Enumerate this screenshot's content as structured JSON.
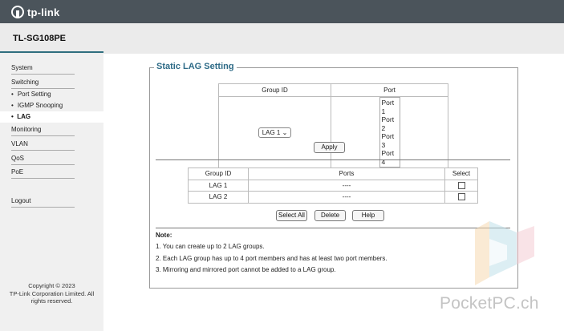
{
  "header": {
    "logo_text": "tp-link",
    "model": "TL-SG108PE"
  },
  "sidebar": {
    "items": [
      {
        "label": "System"
      },
      {
        "label": "Switching"
      },
      {
        "label": "Port Setting"
      },
      {
        "label": "IGMP Snooping"
      },
      {
        "label": "LAG"
      },
      {
        "label": "Monitoring"
      },
      {
        "label": "VLAN"
      },
      {
        "label": "QoS"
      },
      {
        "label": "PoE"
      },
      {
        "label": "Logout"
      }
    ],
    "active": "LAG",
    "copyright": "Copyright © 2023\nTP-Link Corporation Limited. All rights reserved."
  },
  "main": {
    "section_title": "Static LAG Setting",
    "config_table": {
      "headers": [
        "Group ID",
        "Port"
      ],
      "group_select_value": "LAG 1",
      "ports": [
        "Port 1",
        "Port 2",
        "Port 3",
        "Port 4"
      ]
    },
    "apply_label": "Apply",
    "lag_table": {
      "headers": [
        "Group ID",
        "Ports",
        "Select"
      ],
      "rows": [
        {
          "group": "LAG 1",
          "ports": "----"
        },
        {
          "group": "LAG 2",
          "ports": "----"
        }
      ]
    },
    "buttons": {
      "select_all": "Select All",
      "delete": "Delete",
      "help": "Help"
    },
    "note": {
      "title": "Note:",
      "lines": [
        "1. You can create up to 2 LAG groups.",
        "2. Each LAG group has up to 4 port members and has at least two port members.",
        "3. Mirroring and mirrored port cannot be added to a LAG group."
      ]
    }
  },
  "watermark": "PocketPC.ch",
  "colors": {
    "topbar": "#4b545b",
    "accent": "#2e6b87",
    "sidebar_bg": "#f0f0f0"
  }
}
